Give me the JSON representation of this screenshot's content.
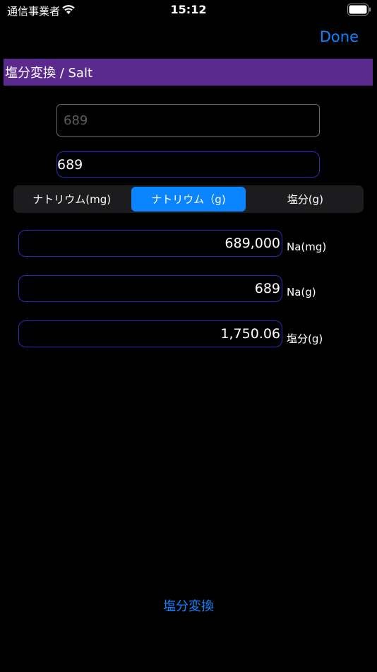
{
  "status_bar": {
    "carrier": "通信事業者",
    "time": "15:12",
    "wifi_icon": "wifi-icon",
    "battery_icon": "battery-icon"
  },
  "nav": {
    "done_label": "Done",
    "title": "塩分変換 / Salt"
  },
  "inputs": {
    "placeholder": "689",
    "amount_value": "689"
  },
  "segments": [
    {
      "label": "ナトリウム(mg)",
      "selected": false
    },
    {
      "label": "ナトリウム（g)",
      "selected": true
    },
    {
      "label": "塩分(g)",
      "selected": false
    }
  ],
  "results": [
    {
      "value": "689,000",
      "unit": "Na(mg)"
    },
    {
      "value": "689",
      "unit": "Na(g)"
    },
    {
      "value": "1,750.06",
      "unit": "塩分(g)"
    }
  ],
  "footer": {
    "link_label": "塩分変換"
  },
  "colors": {
    "accent": "#0a84ff",
    "title_bar": "#5a2a8f",
    "field_border": "#2a2ab5",
    "background": "#000000"
  }
}
